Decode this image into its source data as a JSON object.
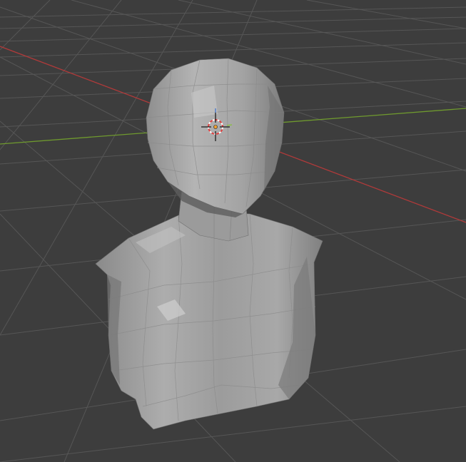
{
  "app": "3D viewport",
  "viewport": {
    "background": "#3d3d3d",
    "grid_color": "#555555",
    "x_axis_color": "#b03a3a",
    "y_axis_color": "#6f9a2e"
  },
  "object": {
    "name": "bust-mesh",
    "shading": "solid",
    "base_color": "#a8a8a8"
  },
  "cursor": {
    "icon": "3d-cursor-icon",
    "ring_colors": [
      "#e04040",
      "#ffffff"
    ]
  }
}
